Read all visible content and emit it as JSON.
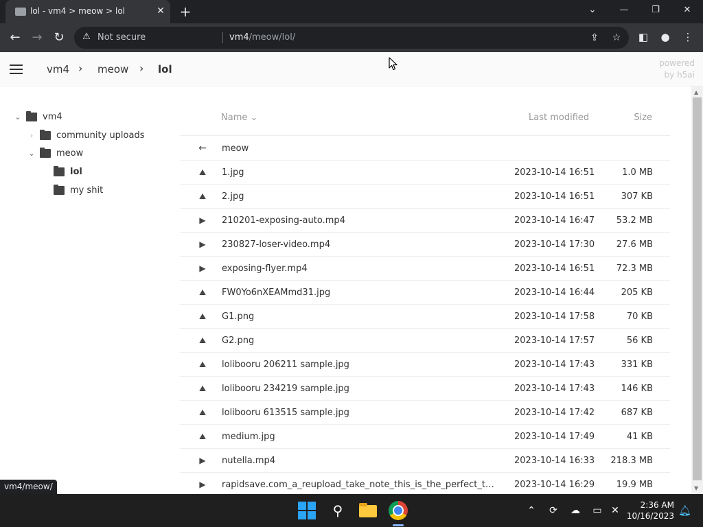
{
  "browser": {
    "tab_title": "lol - vm4 > meow > lol",
    "security_label": "Not secure",
    "url_host": "vm4",
    "url_path": "/meow/lol/"
  },
  "header": {
    "breadcrumbs": [
      "vm4",
      "meow",
      "lol"
    ],
    "powered_line1": "powered",
    "powered_line2": "by h5ai"
  },
  "tree": [
    {
      "label": "vm4",
      "state": "expanded"
    },
    {
      "label": "community uploads",
      "state": "collapsed"
    },
    {
      "label": "meow",
      "state": "expanded"
    },
    {
      "label": "lol",
      "state": "current"
    },
    {
      "label": "my shit",
      "state": "leaf"
    }
  ],
  "table": {
    "headers": {
      "name": "Name",
      "modified": "Last modified",
      "size": "Size"
    },
    "parent": {
      "name": "meow"
    },
    "rows": [
      {
        "icon": "image",
        "name": "1.jpg",
        "modified": "2023-10-14 16:51",
        "size": "1.0 MB"
      },
      {
        "icon": "image",
        "name": "2.jpg",
        "modified": "2023-10-14 16:51",
        "size": "307 KB"
      },
      {
        "icon": "video",
        "name": "210201-exposing-auto.mp4",
        "modified": "2023-10-14 16:47",
        "size": "53.2 MB"
      },
      {
        "icon": "video",
        "name": "230827-loser-video.mp4",
        "modified": "2023-10-14 17:30",
        "size": "27.6 MB"
      },
      {
        "icon": "video",
        "name": "exposing-flyer.mp4",
        "modified": "2023-10-14 16:51",
        "size": "72.3 MB"
      },
      {
        "icon": "image",
        "name": "FW0Yo6nXEAMmd31.jpg",
        "modified": "2023-10-14 16:44",
        "size": "205 KB"
      },
      {
        "icon": "image",
        "name": "G1.png",
        "modified": "2023-10-14 17:58",
        "size": "70 KB"
      },
      {
        "icon": "image",
        "name": "G2.png",
        "modified": "2023-10-14 17:57",
        "size": "56 KB"
      },
      {
        "icon": "image",
        "name": "lolibooru 206211 sample.jpg",
        "modified": "2023-10-14 17:43",
        "size": "331 KB"
      },
      {
        "icon": "image",
        "name": "lolibooru 234219 sample.jpg",
        "modified": "2023-10-14 17:43",
        "size": "146 KB"
      },
      {
        "icon": "image",
        "name": "lolibooru 613515 sample.jpg",
        "modified": "2023-10-14 17:42",
        "size": "687 KB"
      },
      {
        "icon": "image",
        "name": "medium.jpg",
        "modified": "2023-10-14 17:49",
        "size": "41 KB"
      },
      {
        "icon": "video",
        "name": "nutella.mp4",
        "modified": "2023-10-14 16:33",
        "size": "218.3 MB"
      },
      {
        "icon": "video",
        "name": "rapidsave.com_a_reupload_take_note_this_is_the_perfect_type_...",
        "modified": "2023-10-14 16:29",
        "size": "19.9 MB"
      }
    ]
  },
  "status_url": "vm4/meow/",
  "taskbar": {
    "time": "2:36 AM",
    "date": "10/16/2023"
  }
}
